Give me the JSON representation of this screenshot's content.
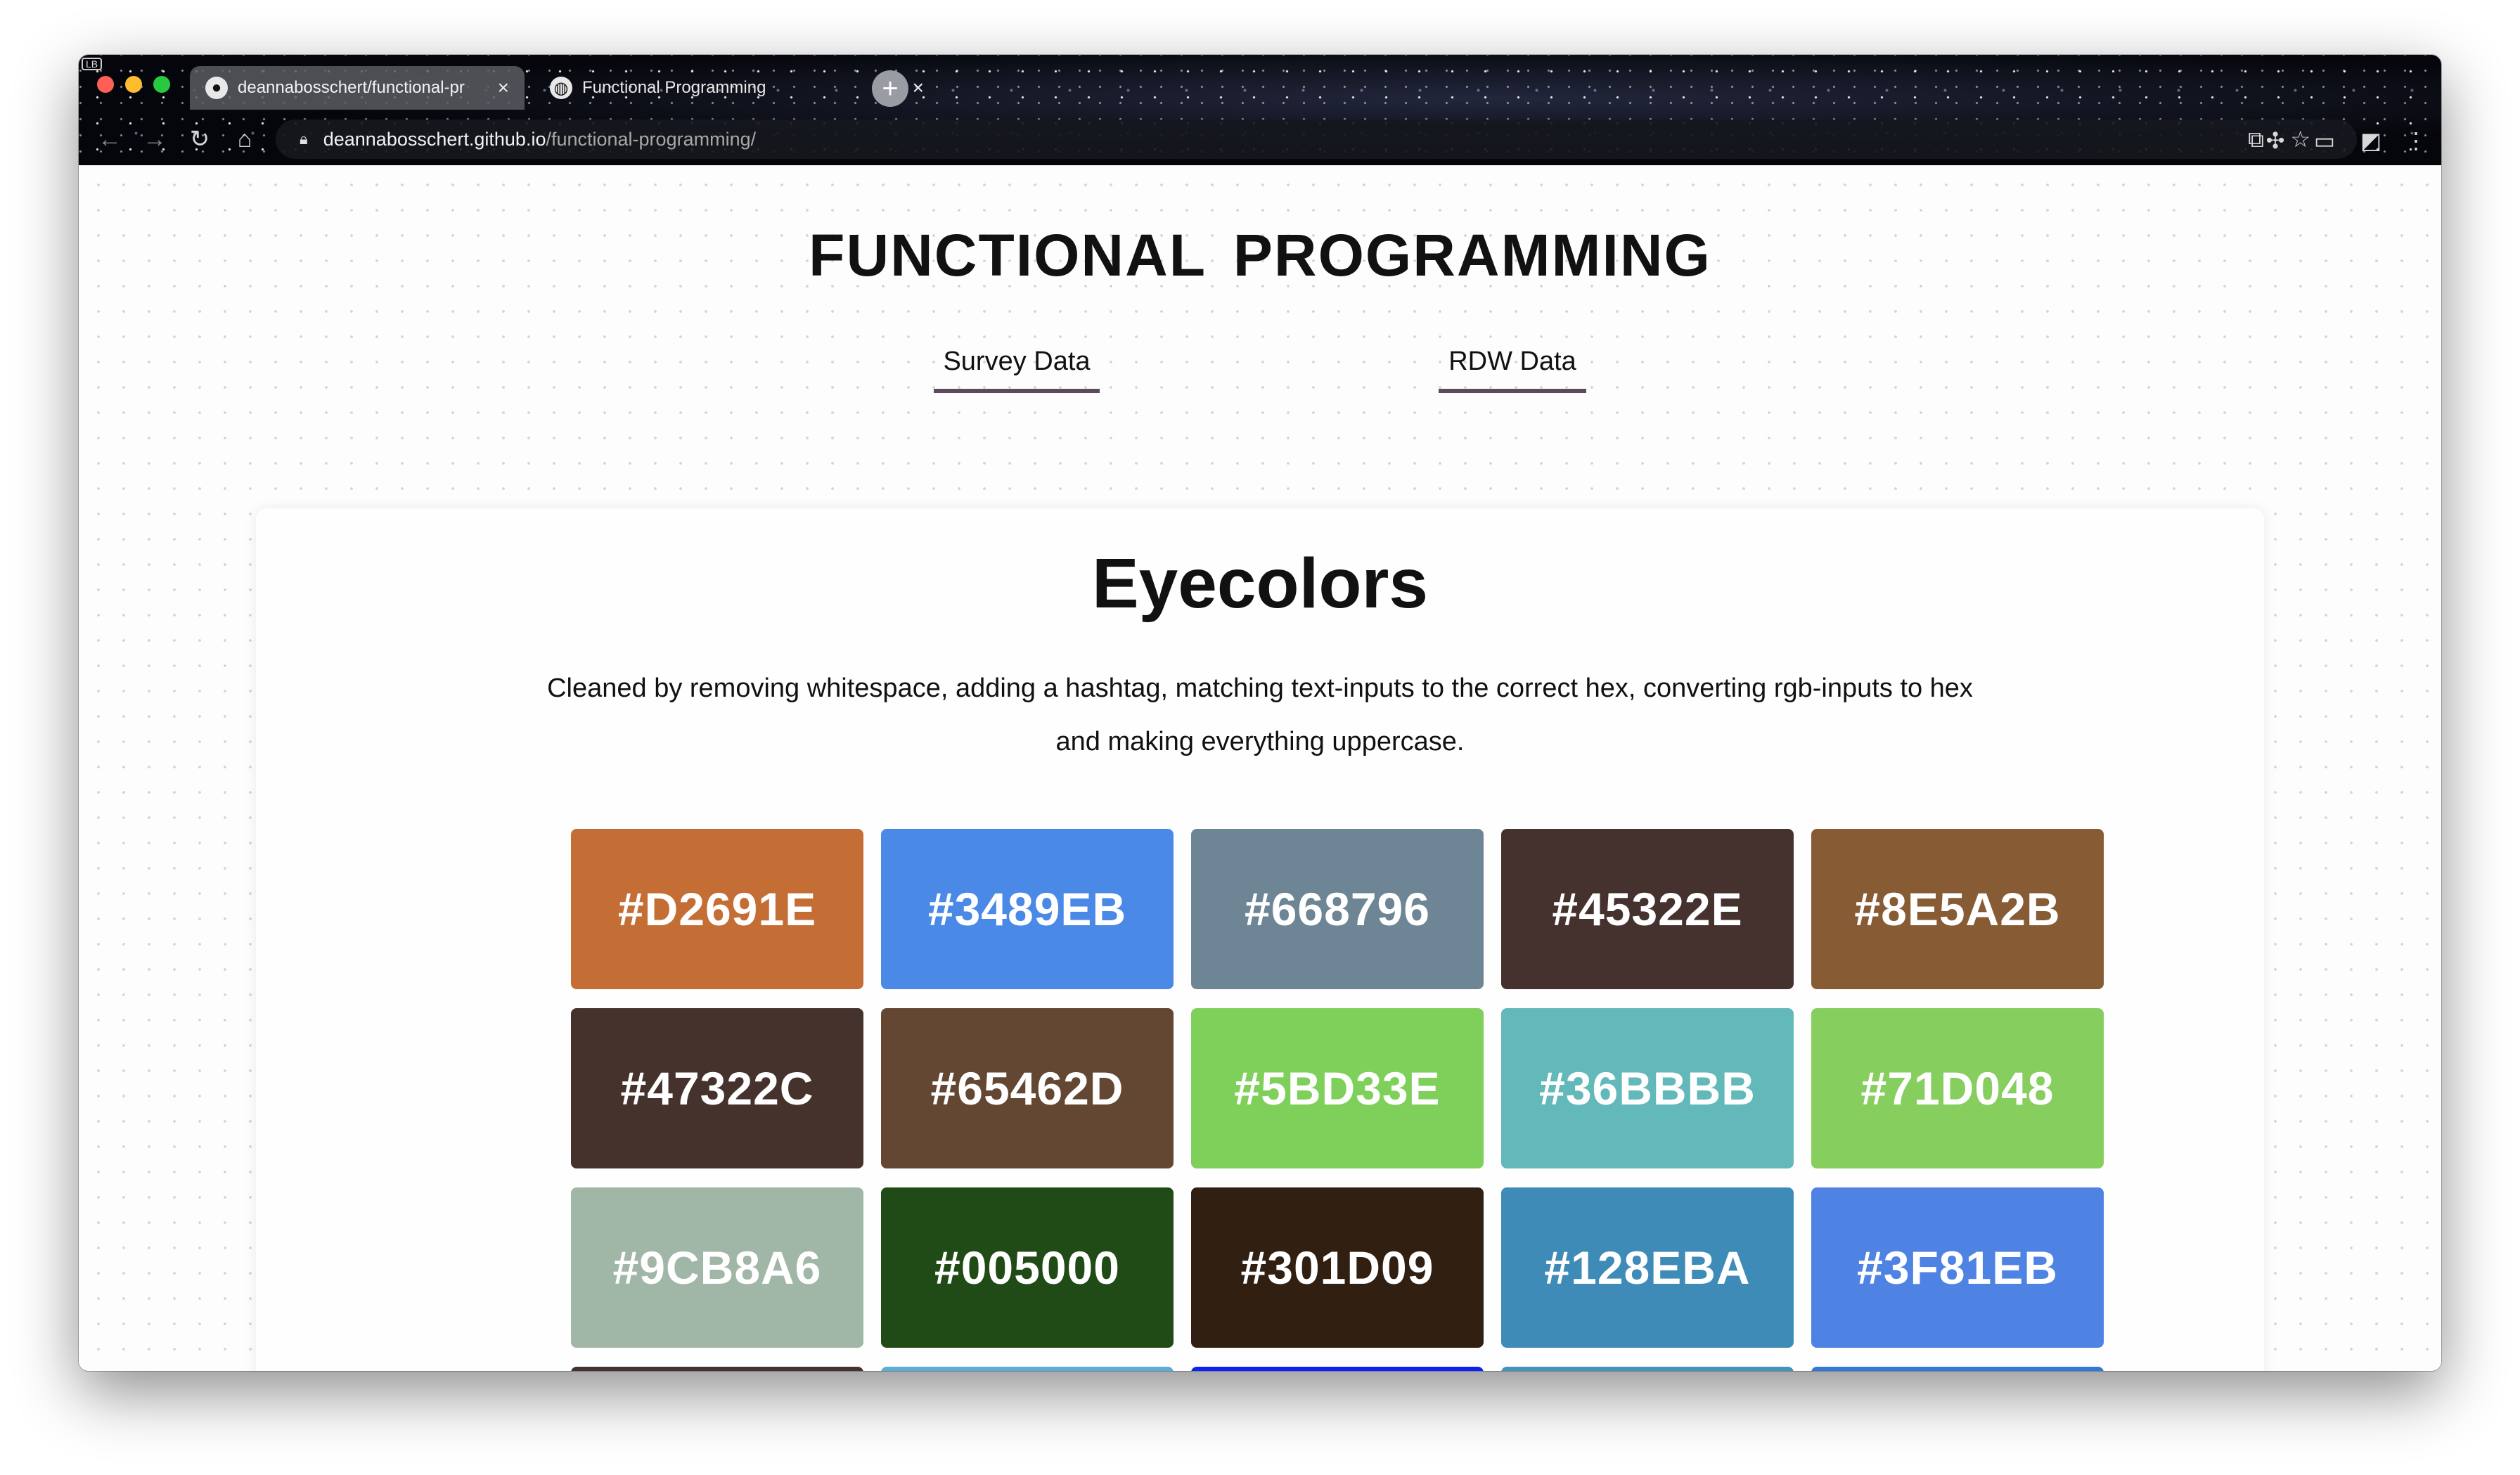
{
  "browser": {
    "profile_badge": "LB",
    "tabs": [
      {
        "title": "deannabosschert/functional-pr",
        "favicon": "github-icon",
        "active": true
      },
      {
        "title": "Functional Programming",
        "favicon": "globe-icon",
        "active": false
      }
    ],
    "new_tab": "+",
    "url_domain": "deannabosschert.github.io",
    "url_path": "/functional-programming/"
  },
  "page": {
    "title": "FUNCTIONAL PROGRAMMING",
    "nav": [
      {
        "label": "Survey Data",
        "active": true
      },
      {
        "label": "RDW Data",
        "active": false
      }
    ],
    "section": {
      "heading": "Eyecolors",
      "description": "Cleaned by removing whitespace, adding a hashtag, matching text-inputs to the correct hex, converting rgb-inputs to hex and making everything uppercase."
    },
    "accent_color": "#5d4a5c",
    "swatches": [
      {
        "label": "#D2691E",
        "color": "#C46E36"
      },
      {
        "label": "#3489EB",
        "color": "#4A89E5"
      },
      {
        "label": "#668796",
        "color": "#6D8594"
      },
      {
        "label": "#45322E",
        "color": "#45322F"
      },
      {
        "label": "#8E5A2B",
        "color": "#875C35"
      },
      {
        "label": "#47322C",
        "color": "#46322D"
      },
      {
        "label": "#65462D",
        "color": "#634732"
      },
      {
        "label": "#5BD33E",
        "color": "#7FD05A"
      },
      {
        "label": "#36BBBB",
        "color": "#63B8B9"
      },
      {
        "label": "#71D048",
        "color": "#86CE5E"
      },
      {
        "label": "#9CB8A6",
        "color": "#A0B6A6"
      },
      {
        "label": "#005000",
        "color": "#204B16"
      },
      {
        "label": "#301D09",
        "color": "#311F11"
      },
      {
        "label": "#128EBA",
        "color": "#3E8BB8"
      },
      {
        "label": "#3F81EB",
        "color": "#4E83E4"
      },
      {
        "label": "",
        "color": "#45322F"
      },
      {
        "label": "",
        "color": "#5BACD9"
      },
      {
        "label": "",
        "color": "#0B22F5"
      },
      {
        "label": "",
        "color": "#4095B8"
      },
      {
        "label": "",
        "color": "#3277D8"
      }
    ]
  }
}
